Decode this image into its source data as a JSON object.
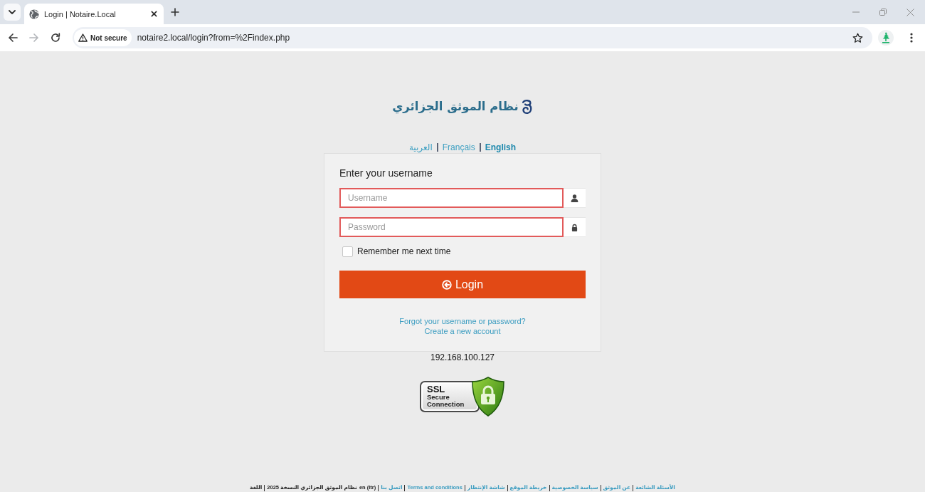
{
  "browser": {
    "tabs": [
      {
        "title": "Login | Notaire.Local",
        "selected": true
      }
    ],
    "nav_buttons": [
      {
        "kind": "back",
        "disabled": false
      },
      {
        "kind": "forward",
        "disabled": true
      },
      {
        "kind": "reload",
        "disabled": false
      }
    ],
    "security_chip": "Not secure",
    "url": "notaire2.local/login?from=%2Findex.php"
  },
  "page": {
    "logo_text": "نظام الموثق الجزائري",
    "languages": [
      {
        "label": "English",
        "selected": true
      },
      {
        "label": "Français",
        "selected": false
      },
      {
        "label": "العربية",
        "selected": false
      }
    ],
    "login": {
      "heading": "Enter your username",
      "fields": [
        {
          "kind": "text",
          "placeholder": "Username",
          "invalid": true
        },
        {
          "kind": "password",
          "placeholder": "Password",
          "invalid": true
        }
      ],
      "remember": {
        "label": "Remember me next time",
        "checked": false
      },
      "button": "Login",
      "links": [
        "Forgot your username or password?",
        "Create a new account"
      ]
    },
    "server_ip": "192.168.100.127",
    "ssl_badge": {
      "title": "SSL",
      "line_2": "Secure",
      "line_3": "Connection"
    }
  },
  "footer": {
    "links": [
      "الأسئلة الشائعة",
      "عن الموثق",
      "سياسة الخصوصية",
      "خريطة الموقع",
      "شاشة الإنتظار",
      "Terms and conditions",
      "اتصل بنا"
    ],
    "language_code": "en (ltr)",
    "version": "نظام الموثق الجزائري النسخة 2025",
    "language_label": "اللغة"
  }
}
